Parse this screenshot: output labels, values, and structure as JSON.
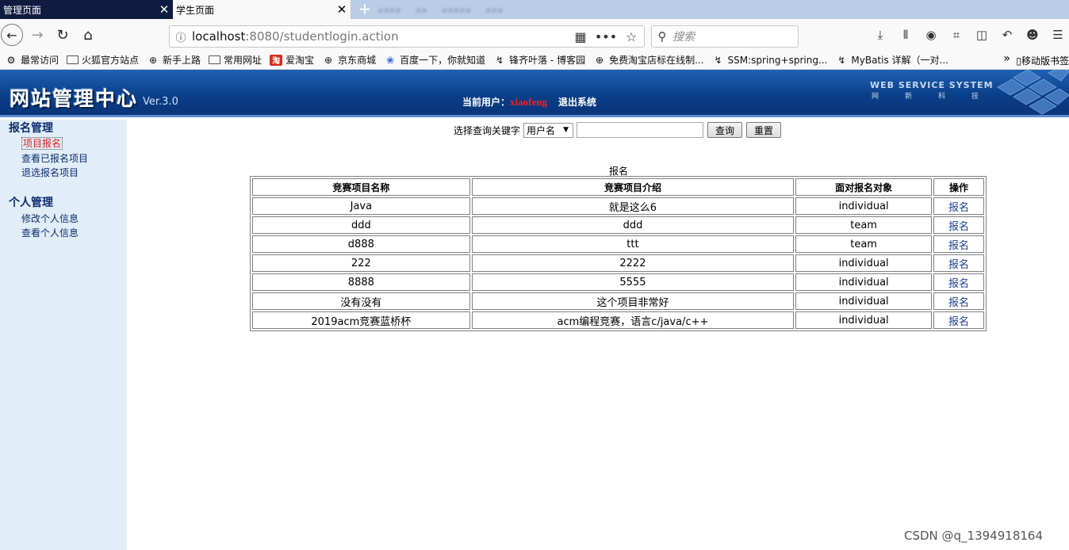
{
  "browser": {
    "tabs": [
      {
        "title": "管理页面",
        "active": false
      },
      {
        "title": "学生页面",
        "active": true
      }
    ],
    "new_tab_icon": "+",
    "url": {
      "host": "localhost",
      "rest": ":8080/studentlogin.action"
    },
    "search_placeholder": "搜索",
    "bookmarks": [
      {
        "label": "最常访问",
        "icon": "gear-icon"
      },
      {
        "label": "火狐官方站点",
        "icon": "folder-icon"
      },
      {
        "label": "新手上路",
        "icon": "globe-icon"
      },
      {
        "label": "常用网址",
        "icon": "folder-icon"
      },
      {
        "label": "爱淘宝",
        "icon": "taobao-icon"
      },
      {
        "label": "京东商城",
        "icon": "globe-icon"
      },
      {
        "label": "百度一下，你就知道",
        "icon": "baidu-icon"
      },
      {
        "label": "锋齐叶落 - 博客园",
        "icon": "blog-icon"
      },
      {
        "label": "免费淘宝店标在线制...",
        "icon": "globe-icon"
      },
      {
        "label": "SSM:spring+spring...",
        "icon": "blog-icon"
      },
      {
        "label": "MyBatis 详解（一对...",
        "icon": "blog-icon"
      }
    ],
    "bookmarks_more": "»",
    "mobile_bookmarks": "移动版书签"
  },
  "header": {
    "logo": "网站管理中心",
    "version": "Ver.3.0",
    "current_user_label": "当前用户：",
    "current_user": "xiaofeng",
    "logout": "退出系统",
    "ws_title": "WEB SERVICE SYSTEM",
    "ws_sub": "网新科技"
  },
  "sidebar": {
    "groups": [
      {
        "title": "报名管理",
        "items": [
          "项目报名",
          "查看已报名项目",
          "退选报名项目"
        ]
      },
      {
        "title": "个人管理",
        "items": [
          "修改个人信息",
          "查看个人信息"
        ]
      }
    ],
    "active_item": "项目报名"
  },
  "query": {
    "label": "选择查询关键字",
    "select_value": "用户名",
    "input_value": "",
    "search_button": "查询",
    "reset_button": "重置"
  },
  "table": {
    "caption": "报名",
    "headers": [
      "竞赛项目名称",
      "竞赛项目介绍",
      "面对报名对象",
      "操作"
    ],
    "rows": [
      [
        "Java",
        "就是这么6",
        "individual",
        "报名"
      ],
      [
        "ddd",
        "ddd",
        "team",
        "报名"
      ],
      [
        "d888",
        "ttt",
        "team",
        "报名"
      ],
      [
        "222",
        "2222",
        "individual",
        "报名"
      ],
      [
        "8888",
        "5555",
        "individual",
        "报名"
      ],
      [
        "没有没有",
        "这个项目非常好",
        "individual",
        "报名"
      ],
      [
        "2019acm竞赛蓝桥杯",
        "acm编程竞赛，语言c/java/c++",
        "individual",
        "报名"
      ]
    ]
  },
  "watermark": "CSDN @q_1394918164",
  "colors": {
    "header_blue": "#0b3f8a",
    "sidebar_bg": "#e1edf7",
    "active_red": "#e21b1b",
    "user_red": "#ff1e1e"
  }
}
